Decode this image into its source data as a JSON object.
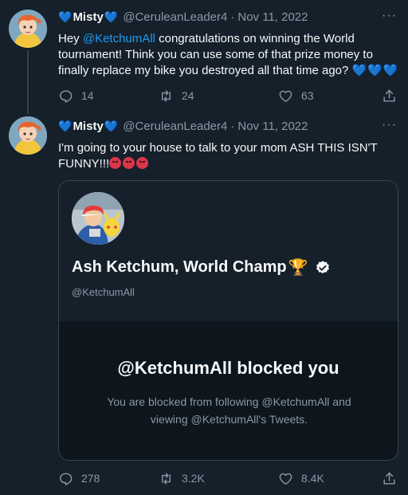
{
  "tweet1": {
    "heart_emoji": "💙",
    "display_name": "Misty",
    "handle": "@CeruleanLeader4",
    "dot": "·",
    "date": "Nov 11, 2022",
    "more": "···",
    "text_before": "Hey ",
    "mention": "@KetchumAll",
    "text_after": " congratulations on winning the World tournament! Think you can use some of that prize money to finally replace my bike you destroyed all that time ago? ",
    "text_hearts": "💙💙💙",
    "replies": "14",
    "retweets": "24",
    "likes": "63"
  },
  "tweet2": {
    "heart_emoji": "💙",
    "display_name": "Misty",
    "handle": "@CeruleanLeader4",
    "dot": "·",
    "date": "Nov 11, 2022",
    "more": "···",
    "text": "I'm going to your house to talk to your mom ASH THIS ISN'T FUNNY!!!",
    "replies": "278",
    "retweets": "3.2K",
    "likes": "8.4K"
  },
  "quoted_card": {
    "name": "Ash Ketchum, World Champ",
    "trophy": "🏆",
    "handle": "@KetchumAll",
    "blocked_title": "@KetchumAll blocked you",
    "blocked_desc": "You are blocked from following @KetchumAll and viewing @KetchumAll's Tweets."
  },
  "colors": {
    "background": "#15202b",
    "accent": "#1d9bf0",
    "muted": "#8b98a5",
    "heart_emoji": "#5da9e9"
  }
}
